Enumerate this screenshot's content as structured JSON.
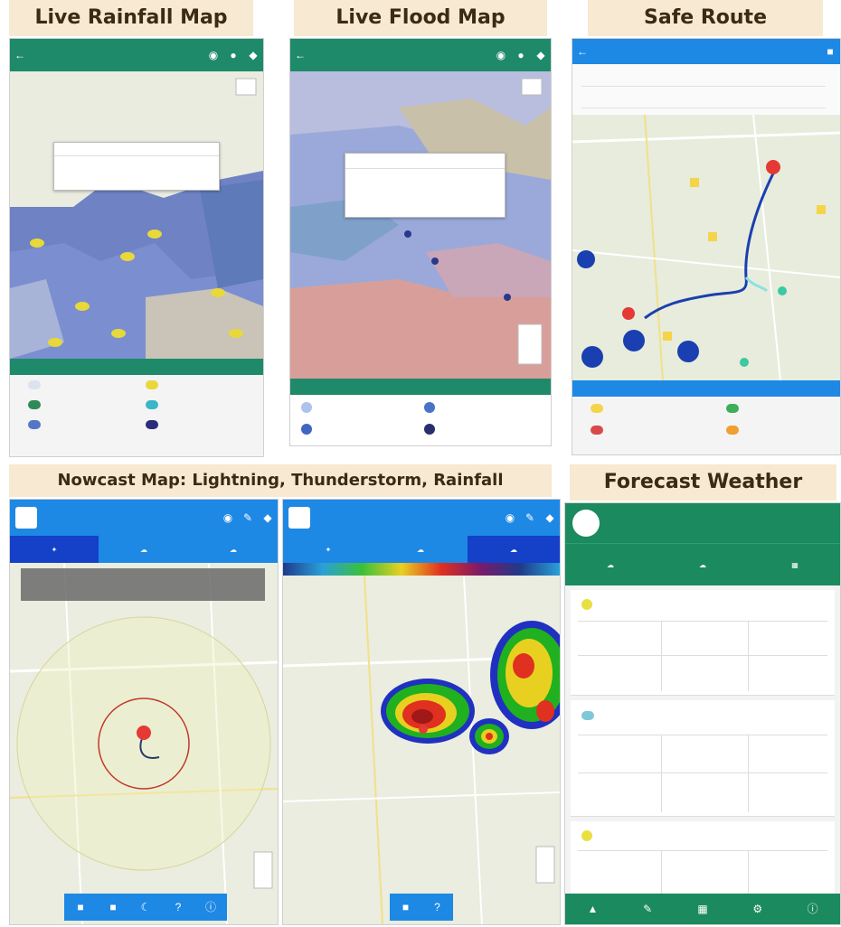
{
  "captions": {
    "rainfall": "Live Rainfall Map",
    "flood": "Live Flood Map",
    "safe_route": "Safe Route",
    "nowcast": "Nowcast Map: Lightning, Thunderstorm, Rainfall",
    "forecast": "Forecast Weather"
  },
  "icons": {
    "back": "back-arrow-icon",
    "eye": "eye-icon",
    "pin": "location-pin-icon",
    "layers": "layers-icon",
    "pencil": "pencil-icon",
    "lightning": "lightning-icon",
    "cloud": "cloud-icon",
    "rain": "rain-icon",
    "menu": "menu-icon"
  },
  "colors": {
    "green_bar": "#1e8a6a",
    "blue_bar": "#1e88e5",
    "dark_blue_tab": "#1540c8",
    "forecast_green": "#1b8a5f",
    "route_line": "#1a3fb0",
    "marker_red": "#e53935"
  }
}
